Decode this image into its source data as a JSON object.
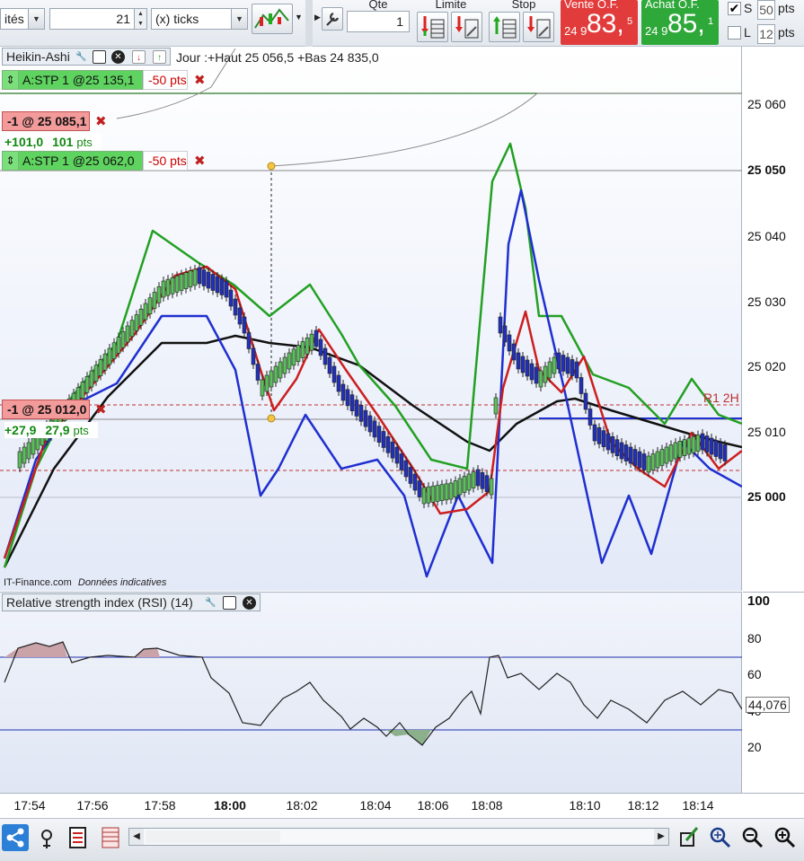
{
  "toolbar": {
    "unit_select": "ités",
    "quantity_ticks": "21",
    "ticks_select": "(x) ticks",
    "qte_label": "Qte",
    "qte_value": "1",
    "limite_label": "Limite",
    "stop_label": "Stop",
    "vente_label": "Vente O.F.",
    "vente_small": "24 9",
    "vente_big": "83,",
    "vente_sup": "5",
    "achat_label": "Achat O.F.",
    "achat_small": "24 9",
    "achat_big": "85,",
    "achat_sup": "1",
    "s_label": "S",
    "s_value": "50",
    "s_unit": "pts",
    "l_label": "L",
    "l_value": "12",
    "l_unit": "pts",
    "colors": {
      "vente": "#e23b3b",
      "achat": "#2fa83a"
    }
  },
  "main_panel": {
    "indicator_name": "Heikin-Ashi",
    "day_info": "Jour :+Haut 25 056,5 +Bas 24 835,0",
    "watermark_brand": "IT-Finance.com",
    "watermark_note": "Données indicatives",
    "orders": [
      {
        "label": "A:STP 1 @25 135,1",
        "pts": "-50 pts"
      },
      {
        "label": "A:STP 1 @25 062,0",
        "pts": "-50 pts"
      }
    ],
    "positions": [
      {
        "label": "-1 @ 25 085,1",
        "pnl_pts": "+101,0",
        "pnl_money": "101",
        "pnl_unit": "pts"
      },
      {
        "label": "-1 @ 25 012,0",
        "pnl_pts": "+27,9",
        "pnl_money": "27,9",
        "pnl_unit": "pts"
      }
    ],
    "pivot_label": "R1 2H"
  },
  "price_axis": {
    "ticks": [
      {
        "label": "25 060",
        "bold": false
      },
      {
        "label": "25 050",
        "bold": true
      },
      {
        "label": "25 040",
        "bold": false
      },
      {
        "label": "25 030",
        "bold": false
      },
      {
        "label": "25 020",
        "bold": false
      },
      {
        "label": "25 010",
        "bold": false
      },
      {
        "label": "25 000",
        "bold": true
      }
    ]
  },
  "rsi_panel": {
    "indicator_name": "Relative strength index (RSI) (14)",
    "current_value": "44,076",
    "ticks": [
      "100",
      "80",
      "60",
      "40",
      "20"
    ]
  },
  "time_axis": {
    "ticks": [
      {
        "label": "17:54",
        "bold": false
      },
      {
        "label": "17:56",
        "bold": false
      },
      {
        "label": "17:58",
        "bold": false
      },
      {
        "label": "18:00",
        "bold": true
      },
      {
        "label": "18:02",
        "bold": false
      },
      {
        "label": "18:04",
        "bold": false
      },
      {
        "label": "18:06",
        "bold": false
      },
      {
        "label": "18:08",
        "bold": false
      },
      {
        "label": "18:10",
        "bold": false
      },
      {
        "label": "18:12",
        "bold": false
      },
      {
        "label": "18:14",
        "bold": false
      }
    ]
  },
  "bottom_bar": {
    "icons": [
      "share-icon",
      "settings-wizard-icon",
      "calculator-icon",
      "ladder-icon",
      "drawing-tool-icon",
      "zoom-fit-icon",
      "zoom-out-icon",
      "zoom-in-icon"
    ]
  }
}
